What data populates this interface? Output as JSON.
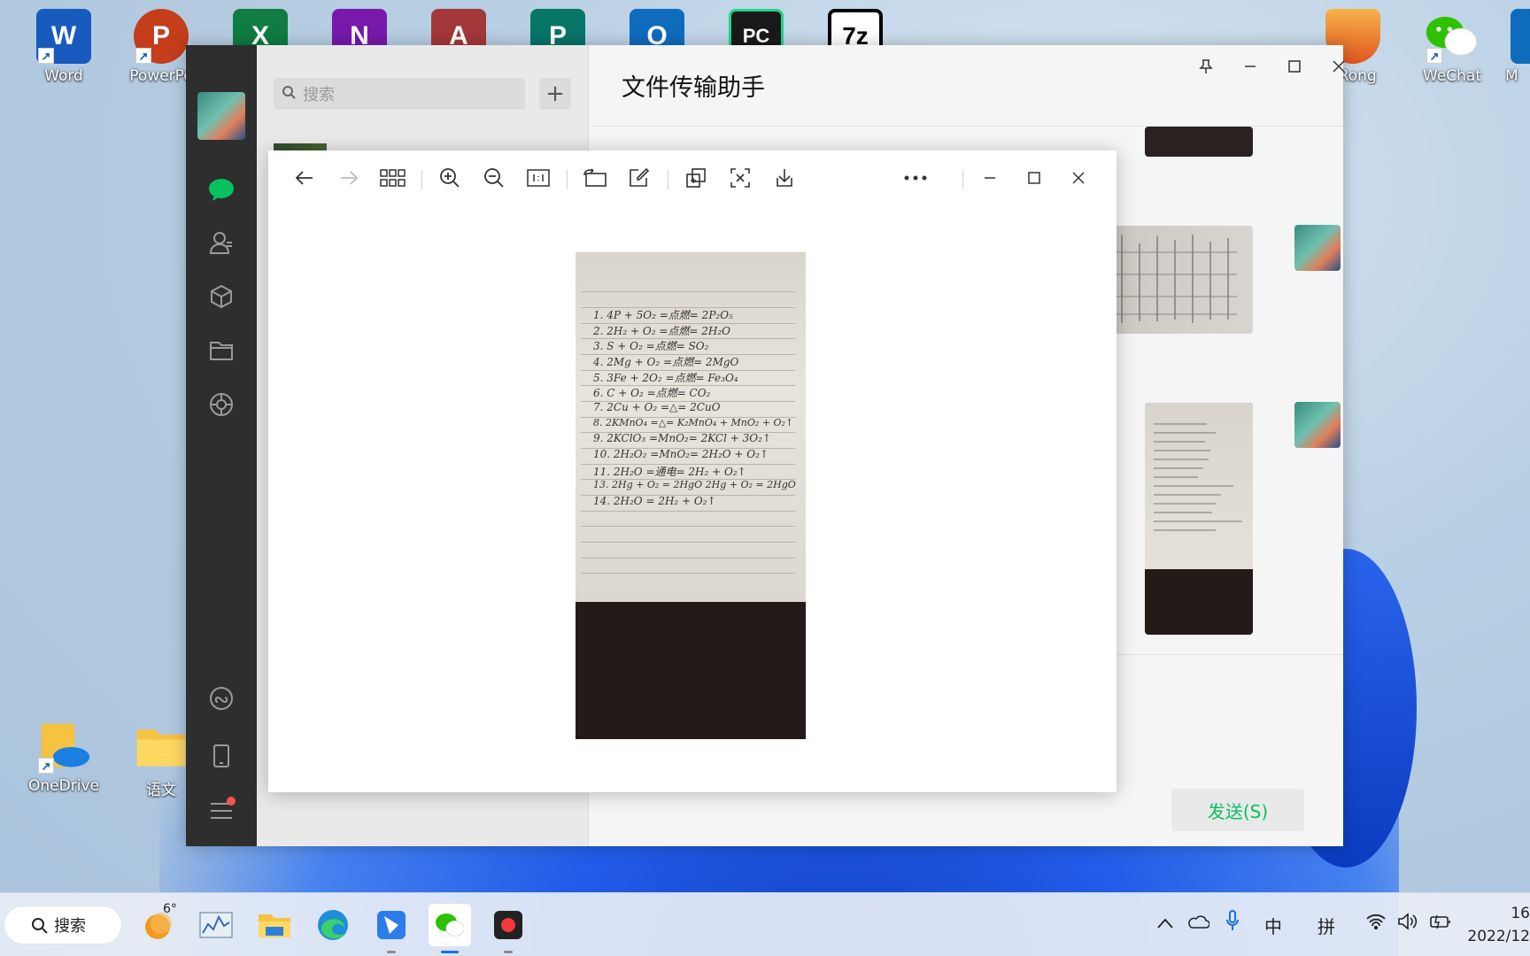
{
  "desktop": {
    "icons": [
      {
        "label": "Word",
        "letter": "W",
        "color": "#185abd"
      },
      {
        "label": "PowerPo",
        "letter": "P",
        "color": "#c43e1c"
      },
      {
        "label": "",
        "letter": "X",
        "color": "#107c41"
      },
      {
        "label": "",
        "letter": "N",
        "color": "#7719aa"
      },
      {
        "label": "",
        "letter": "A",
        "color": "#a4373a"
      },
      {
        "label": "",
        "letter": "P",
        "color": "#077568"
      },
      {
        "label": "",
        "letter": "O",
        "color": "#0f6cbd"
      },
      {
        "label": "",
        "letter": "PC",
        "color": "#1a1a1a"
      },
      {
        "label": "",
        "letter": "7z",
        "color": "#ffffff"
      },
      {
        "label": "eRong",
        "letter": "",
        "color": "#f08a24"
      },
      {
        "label": "WeChat",
        "letter": "",
        "color": "#2dc100"
      },
      {
        "label": "M",
        "letter": "",
        "color": "#0f6cbd"
      },
      {
        "label": "OneDrive",
        "letter": "",
        "color": "#f5c242"
      },
      {
        "label": "语文",
        "letter": "",
        "color": "#f5c242"
      }
    ]
  },
  "wechat": {
    "search_placeholder": "搜索",
    "plus_label": "+",
    "chat_title": "文件传输助手",
    "send_button": "发送(S)"
  },
  "viewer": {
    "handwriting": [
      "1. 4P + 5O₂ =点燃= 2P₂O₅",
      "2. 2H₂ + O₂ =点燃= 2H₂O",
      "3. S + O₂ =点燃= SO₂",
      "4. 2Mg + O₂ =点燃= 2MgO",
      "5. 3Fe + 2O₂ =点燃= Fe₃O₄",
      "6. C + O₂ =点燃= CO₂",
      "7. 2Cu + O₂ =△= 2CuO",
      "8. 2KMnO₄ =△= K₂MnO₄ + MnO₂ + O₂↑",
      "9. 2KClO₃ =MnO₂= 2KCl + 3O₂↑",
      "10. 2H₂O₂ =MnO₂= 2H₂O + O₂↑",
      "11. 2H₂O =通电= 2H₂ + O₂↑",
      "13. 2Hg + O₂ = 2HgO   2Hg + O₂ = 2HgO",
      "14. 2H₂O = 2H₂ + O₂↑"
    ]
  },
  "taskbar": {
    "search_label": "搜索",
    "weather_temp": "6°",
    "ime_mode": "中",
    "ime_pinyin": "拼",
    "time": "16",
    "date": "2022/12"
  }
}
